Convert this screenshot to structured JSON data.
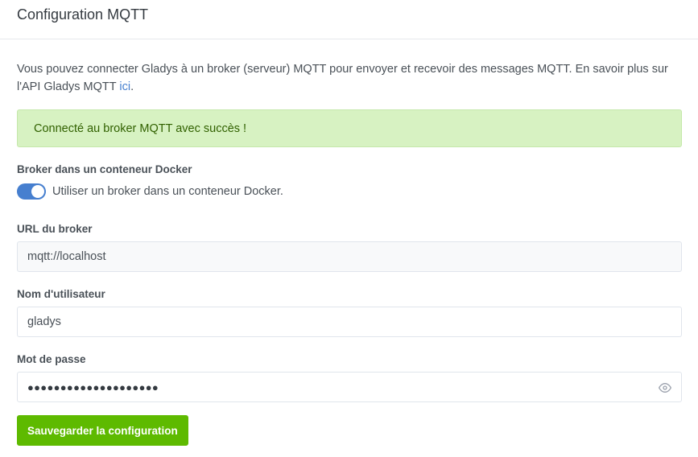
{
  "header": {
    "title": "Configuration MQTT"
  },
  "intro": {
    "text": "Vous pouvez connecter Gladys à un broker (serveur) MQTT pour envoyer et recevoir des messages MQTT. En savoir plus sur l'API Gladys MQTT ",
    "link_text": "ici",
    "suffix": "."
  },
  "alert": {
    "text": "Connecté au broker MQTT avec succès !",
    "color": "#d7f2c2"
  },
  "docker": {
    "label": "Broker dans un conteneur Docker",
    "toggle_label": "Utiliser un broker dans un conteneur Docker.",
    "enabled": true
  },
  "url_field": {
    "label": "URL du broker",
    "value": "mqtt://localhost"
  },
  "username_field": {
    "label": "Nom d'utilisateur",
    "value": "gladys"
  },
  "password_field": {
    "label": "Mot de passe",
    "masked_value": "●●●●●●●●●●●●●●●●●●●●",
    "toggle_icon": "eye-icon"
  },
  "save_button": {
    "label": "Sauvegarder la configuration",
    "color": "#5eba00"
  },
  "colors": {
    "accent": "#467fcf",
    "success": "#5eba00"
  }
}
